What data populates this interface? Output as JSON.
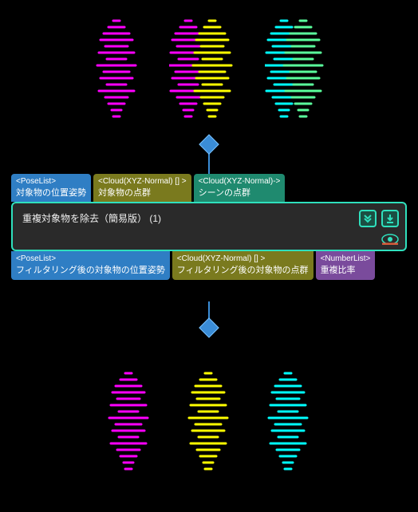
{
  "node": {
    "title": "重複対象物を除去（簡易版）  (1)"
  },
  "inputs": [
    {
      "type": "<PoseList>",
      "label": "対象物の位置姿勢",
      "color": "blue"
    },
    {
      "type": "<Cloud(XYZ-Normal) [] >",
      "label": "対象物の点群",
      "color": "olive"
    },
    {
      "type": "<Cloud(XYZ-Normal)->",
      "label": "シーンの点群",
      "color": "teal"
    }
  ],
  "outputs": [
    {
      "type": "<PoseList>",
      "label": "フィルタリング後の対象物の位置姿勢",
      "color": "blue"
    },
    {
      "type": "<Cloud(XYZ-Normal) [] >",
      "label": "フィルタリング後の対象物の点群",
      "color": "olive"
    },
    {
      "type": "<NumberList>",
      "label": "重複比率",
      "color": "purple"
    }
  ],
  "icons": {
    "expand": "expand-icon",
    "run": "run-icon",
    "eye": "visibility-icon"
  },
  "colors": {
    "magenta": "#ff00ff",
    "yellow": "#ffff00",
    "cyan": "#00ffff",
    "green": "#5aff9c",
    "accent": "#2fe0bd",
    "connector": "#3a8cd6"
  },
  "pointclouds": {
    "top": [
      "magenta",
      "magenta+yellow",
      "cyan+green"
    ],
    "bottom": [
      "magenta",
      "yellow",
      "cyan"
    ]
  }
}
